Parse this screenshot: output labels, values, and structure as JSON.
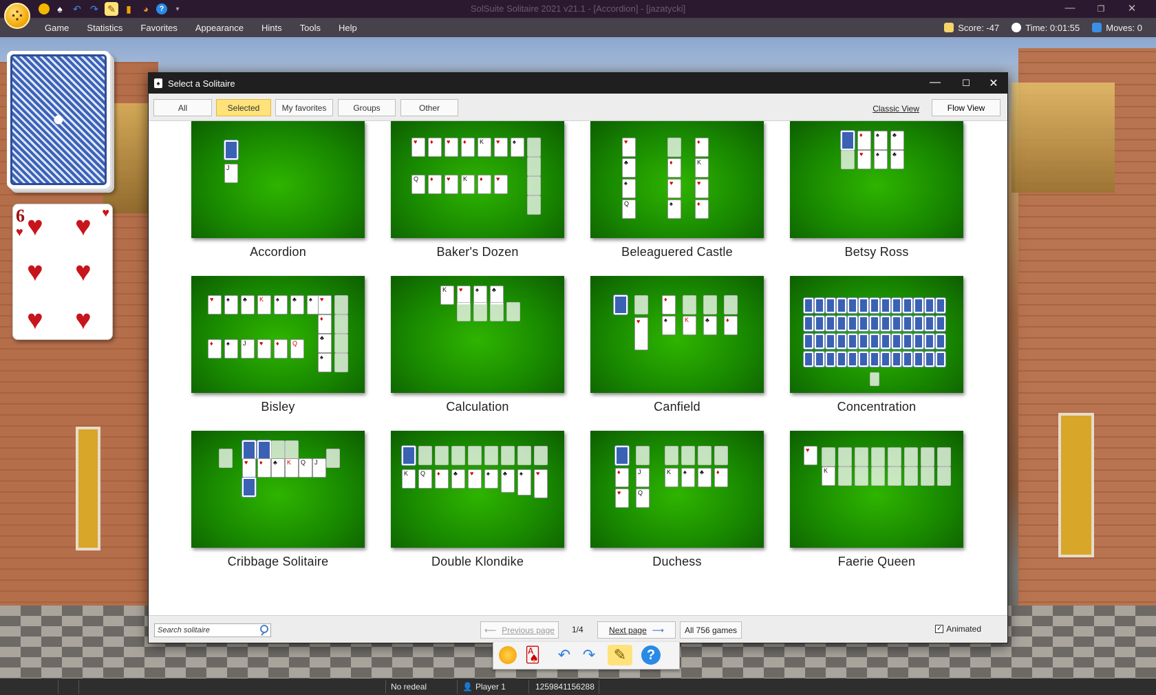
{
  "titlebar": {
    "window_title": "SolSuite Solitaire 2021 v21.1 - [Accordion] - [jazatycki]"
  },
  "menubar": {
    "items": [
      "Game",
      "Statistics",
      "Favorites",
      "Appearance",
      "Hints",
      "Tools",
      "Help"
    ],
    "score": "Score: -47",
    "time": "Time: 0:01:55",
    "moves": "Moves: 0"
  },
  "left_cards": {
    "face_card_rank": "6",
    "face_card_suit": "♥"
  },
  "dialog": {
    "title": "Select a Solitaire",
    "tabs": [
      "All",
      "Selected",
      "My favorites",
      "Groups",
      "Other"
    ],
    "active_tab": "Selected",
    "classic_view": "Classic View",
    "flow_view": "Flow View",
    "games": [
      "Accordion",
      "Baker's Dozen",
      "Beleaguered Castle",
      "Betsy Ross",
      "Bisley",
      "Calculation",
      "Canfield",
      "Concentration",
      "Cribbage Solitaire",
      "Double Klondike",
      "Duchess",
      "Faerie Queen"
    ],
    "footer": {
      "search_placeholder": "Search solitaire",
      "previous_page": "Previous page",
      "page_indicator": "1/4",
      "next_page": "Next page",
      "all_games": "All 756 games",
      "animated": "Animated"
    }
  },
  "statusbar": {
    "redeal": "No redeal",
    "player": "Player 1",
    "game_number": "1259841156288"
  },
  "colors": {
    "accent_tab": "#ffe27a",
    "thumb_green": "#198a00",
    "titlebar": "#2b1a2f"
  }
}
